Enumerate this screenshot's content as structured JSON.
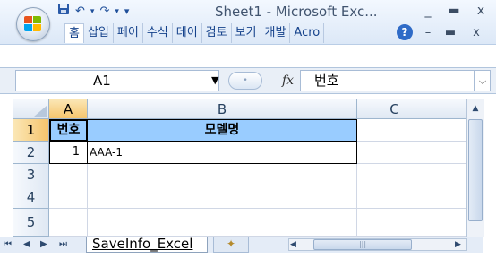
{
  "window": {
    "title": "Sheet1 - Microsoft Exc...",
    "minimize_label": "_",
    "maximize_label": "▬",
    "close_label": "x"
  },
  "quick_access": [
    {
      "icon": "save-icon",
      "glyph": "💾"
    },
    {
      "icon": "undo-icon",
      "glyph": "↶"
    },
    {
      "icon": "redo-icon",
      "glyph": "↷"
    },
    {
      "icon": "customize-qat-icon",
      "glyph": "▾"
    }
  ],
  "ribbon": {
    "tabs": [
      {
        "label": "홈",
        "active": true
      },
      {
        "label": "삽입"
      },
      {
        "label": "페이"
      },
      {
        "label": "수식"
      },
      {
        "label": "데이"
      },
      {
        "label": "검토"
      },
      {
        "label": "보기"
      },
      {
        "label": "개발"
      },
      {
        "label": "Acro"
      }
    ],
    "help_glyph": "?",
    "minimize_glyph": "–",
    "restore_glyph": "▬",
    "close_glyph": "x"
  },
  "formula_bar": {
    "name_box": "A1",
    "fx_label": "fx",
    "content": "번호",
    "expand_glyph": "⌵"
  },
  "columns": [
    "A",
    "B",
    "C"
  ],
  "rows": [
    "1",
    "2",
    "3",
    "4",
    "5"
  ],
  "cells": {
    "A1": "번호",
    "B1": "모델명",
    "A2": "1",
    "B2": "AAA-1"
  },
  "sheet_tabs": {
    "active": "SaveInfo_Excel",
    "nav": [
      "⏮",
      "◀",
      "▶",
      "⏭"
    ]
  },
  "colors": {
    "header_fill": "#99ccff",
    "accent": "#15428b"
  }
}
